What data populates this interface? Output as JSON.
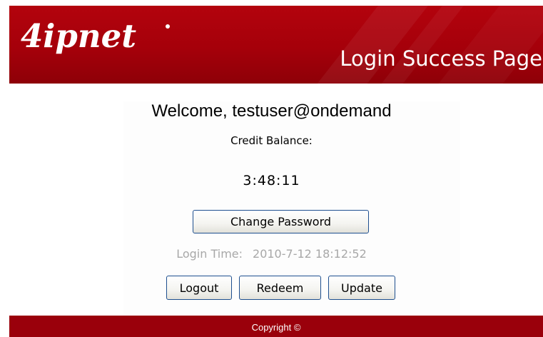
{
  "header": {
    "logo_text": "4ipnet",
    "page_title": "Login Success Page"
  },
  "main": {
    "welcome_text": "Welcome, testuser@ondemand",
    "credit_label": "Credit Balance:",
    "credit_value": "3:48:11",
    "change_password_label": "Change Password",
    "login_time_label": "Login Time:",
    "login_time_value": "2010-7-12 18:12:52",
    "logout_label": "Logout",
    "redeem_label": "Redeem",
    "update_label": "Update"
  },
  "footer": {
    "copyright_text": "Copyright ©"
  },
  "colors": {
    "brand_red": "#a5000a",
    "footer_red": "#9a000b",
    "button_border": "#1e4f8f",
    "muted_text": "#a8a8a8"
  }
}
